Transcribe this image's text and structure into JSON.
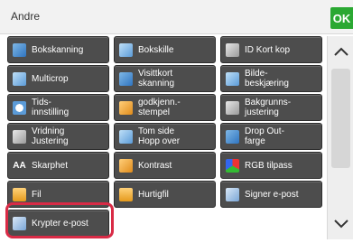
{
  "header": {
    "title": "Andre",
    "ok_label": "OK"
  },
  "tiles": [
    {
      "label": "Bokskanning",
      "icon": "book-scan-icon"
    },
    {
      "label": "Bokskille",
      "icon": "book-divider-icon"
    },
    {
      "label": "ID Kort kop",
      "icon": "id-card-copy-icon"
    },
    {
      "label": "Multicrop",
      "icon": "multicrop-icon"
    },
    {
      "label": "Visittkort\nskanning",
      "icon": "business-card-scan-icon"
    },
    {
      "label": "Bilde-\nbeskjæring",
      "icon": "image-crop-icon"
    },
    {
      "label": "Tids-\ninnstilling",
      "icon": "clock-icon"
    },
    {
      "label": "godkjenn.-\nstempel",
      "icon": "approval-stamp-icon"
    },
    {
      "label": "Bakgrunns-\njustering",
      "icon": "background-adjust-icon"
    },
    {
      "label": "Vridning\nJustering",
      "icon": "skew-adjust-icon"
    },
    {
      "label": "Tom side\nHopp over",
      "icon": "blank-page-skip-icon"
    },
    {
      "label": "Drop Out-\nfarge",
      "icon": "drop-out-color-icon"
    },
    {
      "label": "Skarphet",
      "icon": "sharpness-icon"
    },
    {
      "label": "Kontrast",
      "icon": "contrast-icon"
    },
    {
      "label": "RGB tilpass",
      "icon": "rgb-adjust-icon"
    },
    {
      "label": "Fil",
      "icon": "folder-icon"
    },
    {
      "label": "Hurtigfil",
      "icon": "quick-file-icon"
    },
    {
      "label": "Signer e-post",
      "icon": "sign-email-icon"
    },
    {
      "label": "Krypter e-post",
      "icon": "encrypt-email-icon"
    }
  ],
  "scrollbar": {
    "up_icon": "chevron-up-icon",
    "down_icon": "chevron-down-icon"
  },
  "colors": {
    "tile": "#4d4d4d",
    "ok": "#2aa832",
    "highlight": "#d92b46",
    "background": "#ffffff"
  }
}
